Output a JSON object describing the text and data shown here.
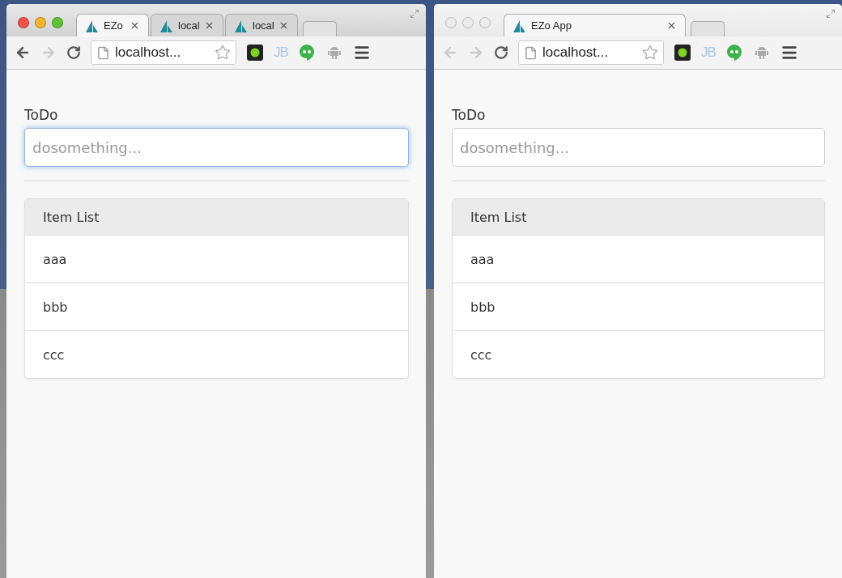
{
  "windows": [
    {
      "active": true,
      "tabs": [
        {
          "title": "EZo",
          "selected": true
        },
        {
          "title": "local",
          "selected": false
        },
        {
          "title": "local",
          "selected": false
        }
      ],
      "back_enabled": true,
      "forward_enabled": false,
      "address": "localhost...",
      "extensions": [
        {
          "kind": "record"
        },
        {
          "kind": "text",
          "label": "JB"
        },
        {
          "kind": "hangouts"
        },
        {
          "kind": "android"
        }
      ],
      "page": {
        "label": "ToDo",
        "placeholder": "dosomething...",
        "focused": true,
        "list_title": "Item List",
        "items": [
          "aaa",
          "bbb",
          "ccc"
        ]
      }
    },
    {
      "active": false,
      "tabs": [
        {
          "title": "EZo App",
          "selected": true
        }
      ],
      "back_enabled": false,
      "forward_enabled": false,
      "address": "localhost...",
      "extensions": [
        {
          "kind": "record"
        },
        {
          "kind": "text",
          "label": "JB"
        },
        {
          "kind": "hangouts"
        },
        {
          "kind": "android"
        }
      ],
      "page": {
        "label": "ToDo",
        "placeholder": "dosomething...",
        "focused": false,
        "list_title": "Item List",
        "items": [
          "aaa",
          "bbb",
          "ccc"
        ]
      }
    }
  ]
}
